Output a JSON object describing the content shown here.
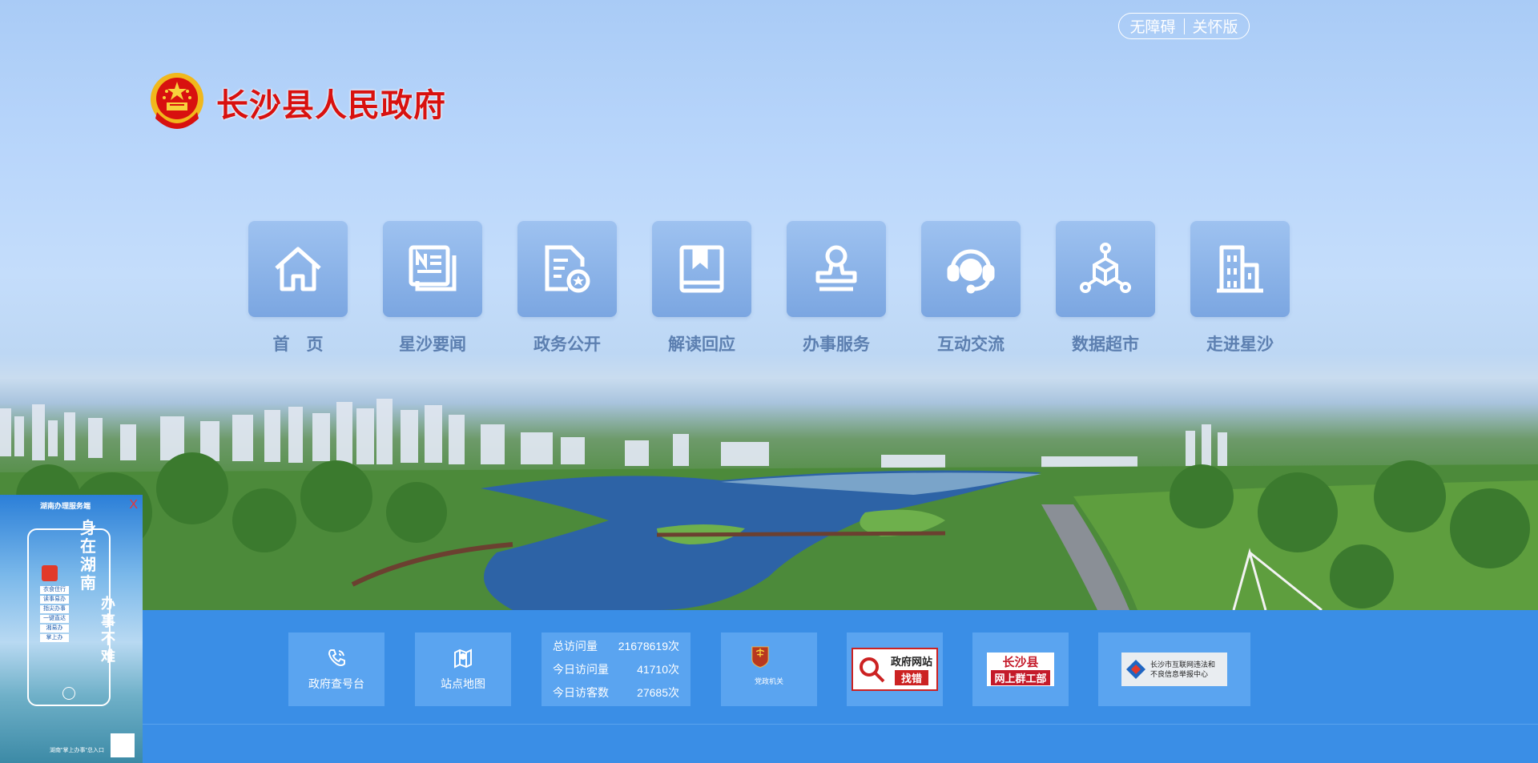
{
  "top_links": {
    "accessibility": "无障碍",
    "elder_mode": "关怀版"
  },
  "site": {
    "title": "长沙县人民政府"
  },
  "nav": [
    {
      "label": "首　页",
      "icon": "home-icon"
    },
    {
      "label": "星沙要闻",
      "icon": "newspaper-icon"
    },
    {
      "label": "政务公开",
      "icon": "document-badge-icon"
    },
    {
      "label": "解读回应",
      "icon": "book-icon"
    },
    {
      "label": "办事服务",
      "icon": "stamp-icon"
    },
    {
      "label": "互动交流",
      "icon": "headset-icon"
    },
    {
      "label": "数据超市",
      "icon": "data-cube-icon"
    },
    {
      "label": "走进星沙",
      "icon": "building-icon"
    }
  ],
  "footer": {
    "hotline": "政府查号台",
    "sitemap": "站点地图",
    "stats": [
      {
        "label": "总访问量",
        "value": "21678619次"
      },
      {
        "label": "今日访问量",
        "value": "41710次"
      },
      {
        "label": "今日访客数",
        "value": "27685次"
      }
    ],
    "party_badge": "党政机关",
    "error_report": {
      "line1": "政府网站",
      "line2": "找错"
    },
    "county_union": {
      "line1": "长沙县",
      "line2": "网上群工部"
    },
    "report_center": {
      "line1": "长沙市互联网违法和",
      "line2": "不良信息举报中心"
    }
  },
  "promo": {
    "header": "湖南办理服务端",
    "slogan1": "身在湖南",
    "slogan2": "办事不难",
    "services": [
      "衣食住行",
      "读事易办",
      "指尖办事",
      "一键直达",
      "湘易办",
      "掌上办"
    ],
    "footer": "湖南\"掌上办事\"总入口",
    "close": "X"
  },
  "colors": {
    "footer_bg": "#3a8ee6",
    "title_red": "#d8110f",
    "nav_label": "#5c7fb0"
  }
}
